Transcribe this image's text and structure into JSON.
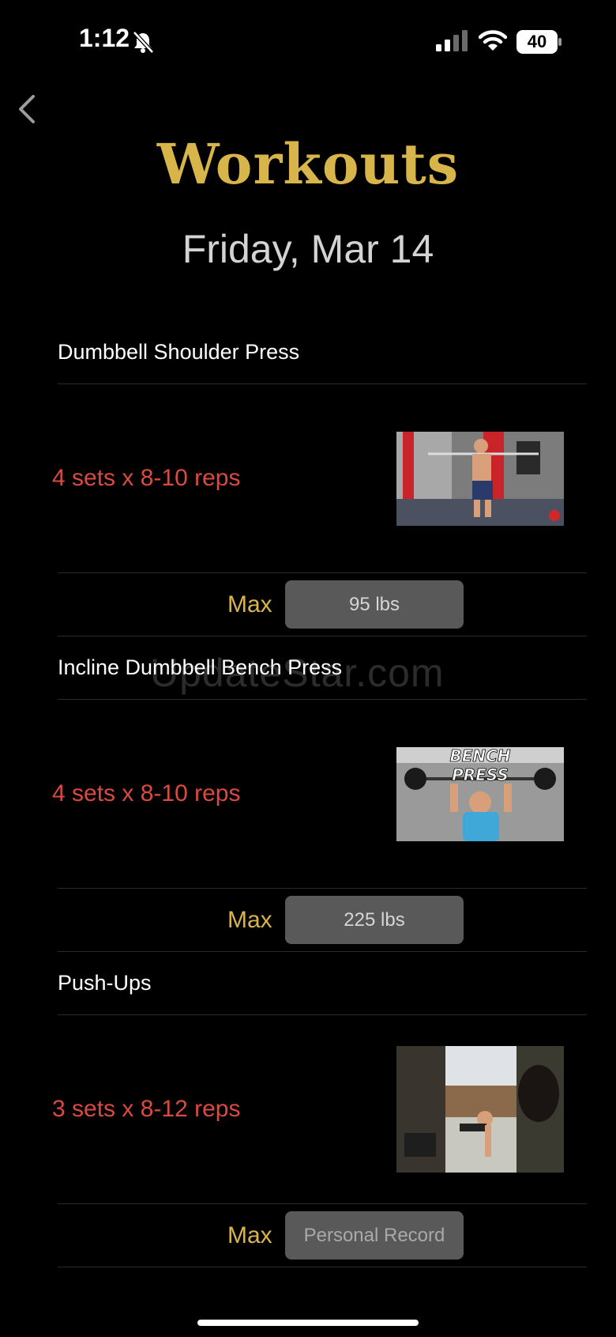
{
  "status_bar": {
    "time": "1:12",
    "battery": "40"
  },
  "header": {
    "title": "Workouts",
    "date": "Friday, Mar 14"
  },
  "watermark": "UpdateStar.com",
  "exercises": [
    {
      "name": "Dumbbell Shoulder Press",
      "scheme": "4 sets x 8-10 reps",
      "max_label": "Max",
      "max_value": "95 lbs"
    },
    {
      "name": "Incline Dumbbell Bench Press",
      "scheme": "4 sets x 8-10 reps",
      "max_label": "Max",
      "max_value": "225 lbs",
      "thumb_text_1": "BENCH",
      "thumb_text_2": "PRESS"
    },
    {
      "name": "Push-Ups",
      "scheme": "3 sets x 8-12 reps",
      "max_label": "Max",
      "max_placeholder": "Personal Record"
    }
  ],
  "colors": {
    "accent_gold": "#d8b54a",
    "sets_red": "#d94a41",
    "input_bg": "#595959"
  }
}
